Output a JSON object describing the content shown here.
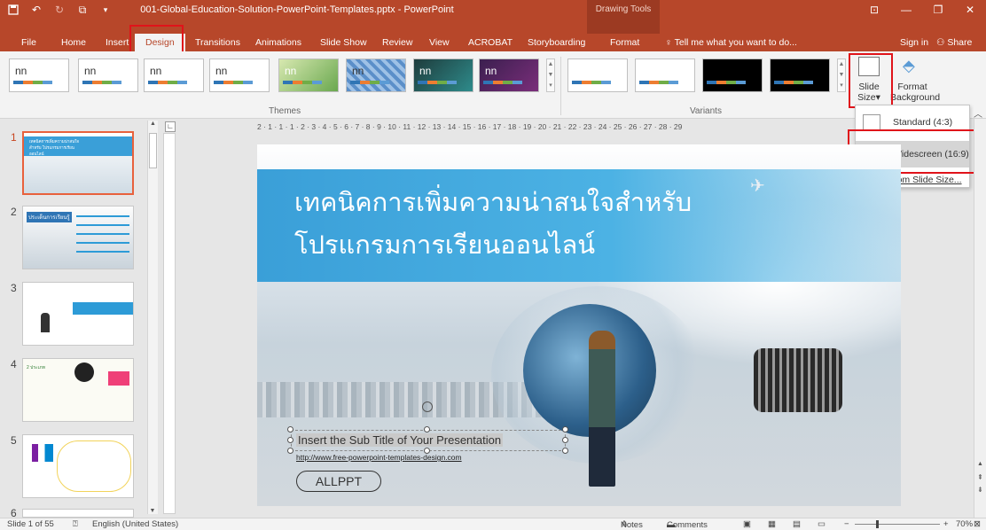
{
  "window": {
    "title": "001-Global-Education-Solution-PowerPoint-Templates.pptx - PowerPoint",
    "context_tab_title": "Drawing Tools",
    "tell_me": "Tell me what you want to do...",
    "sign_in": "Sign in",
    "share": "Share"
  },
  "tabs": [
    "File",
    "Home",
    "Insert",
    "Design",
    "Transitions",
    "Animations",
    "Slide Show",
    "Review",
    "View",
    "ACROBAT",
    "Storyboarding",
    "Format"
  ],
  "ribbon": {
    "themes_label": "Themes",
    "variants_label": "Variants",
    "theme_thumb_text": "nn",
    "slide_size_label": "Slide",
    "slide_size_label2": "Size",
    "format_bg_label": "Format",
    "format_bg_label2": "Background"
  },
  "slide_size_menu": {
    "standard": "Standard (4:3)",
    "widescreen": "Widescreen (16:9)",
    "custom": "Custom Slide Size..."
  },
  "slides": [
    {
      "number": "1",
      "heading": "เทคนิคการเพิ่มความน่าสนใจสำหรับ โปรแกรมการเรียนออนไลน์"
    },
    {
      "number": "2",
      "heading": "ประเด็นการเรียนรู้"
    },
    {
      "number": "3"
    },
    {
      "number": "4",
      "heading": "2 ประเภท"
    },
    {
      "number": "5"
    },
    {
      "number": "6"
    }
  ],
  "ruler": {
    "horizontal": "2 · 1 · 1 · 1 · 2 · 3 · 4 · 5 · 6 · 7 · 8 · 9 · 10 · 11 · 12 · 13 · 14 · 15 · 16 · 17 · 18 · 19 · 20 · 21 · 22 · 23 · 24 · 25 · 26 · 27 · 28 · 29"
  },
  "slide": {
    "title_line1": "เทคนิคการเพิ่มความน่าสนใจสำหรับ",
    "title_line2": "โปรแกรมการเรียนออนไลน์",
    "subtitle": "Insert the Sub Title of Your Presentation",
    "url": "http://www.free-powerpoint-templates-design.com",
    "logo": "ALLPPT"
  },
  "status": {
    "slide_info": "Slide 1 of 55",
    "language": "English (United States)",
    "notes": "Notes",
    "comments": "Comments",
    "zoom": "70%"
  }
}
